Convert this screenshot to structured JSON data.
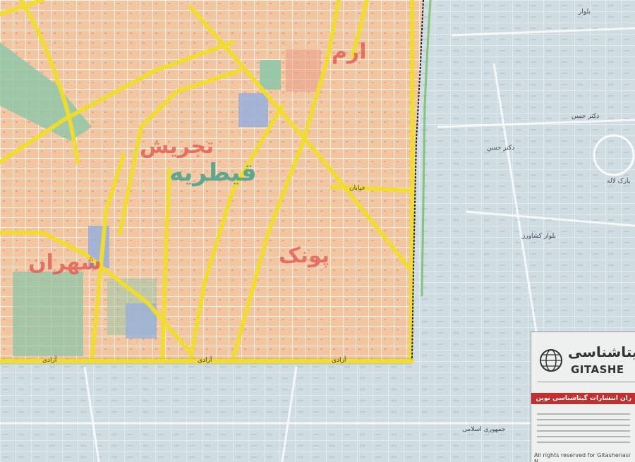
{
  "map": {
    "districts": [
      "ارم",
      "تجریش",
      "قیطریه",
      "پونک",
      "شهران"
    ],
    "street_labels": [
      "آزادی",
      "آزادی",
      "آزادی",
      "بلوار",
      "بلوار کشاورز",
      "خیابان",
      "دکتر حسن",
      "دکتر حسن",
      "پارک لاله",
      "جمهوری اسلامی"
    ],
    "legend": {
      "brand_arabic": "گیتاشناسی",
      "brand_english": "GITASHE",
      "notice": "ران انتشارات گیتاشناسی نوین محفوظ است",
      "copyright": "All rights reserved for Gitashenasi N"
    }
  },
  "colors": {
    "built_up": "#f2c6a0",
    "outer_area": "#cfdde3",
    "highway": "#f1de2c",
    "park": "#8fc6a8",
    "water": "#9bb0d8",
    "district_text": "#e0524e"
  }
}
